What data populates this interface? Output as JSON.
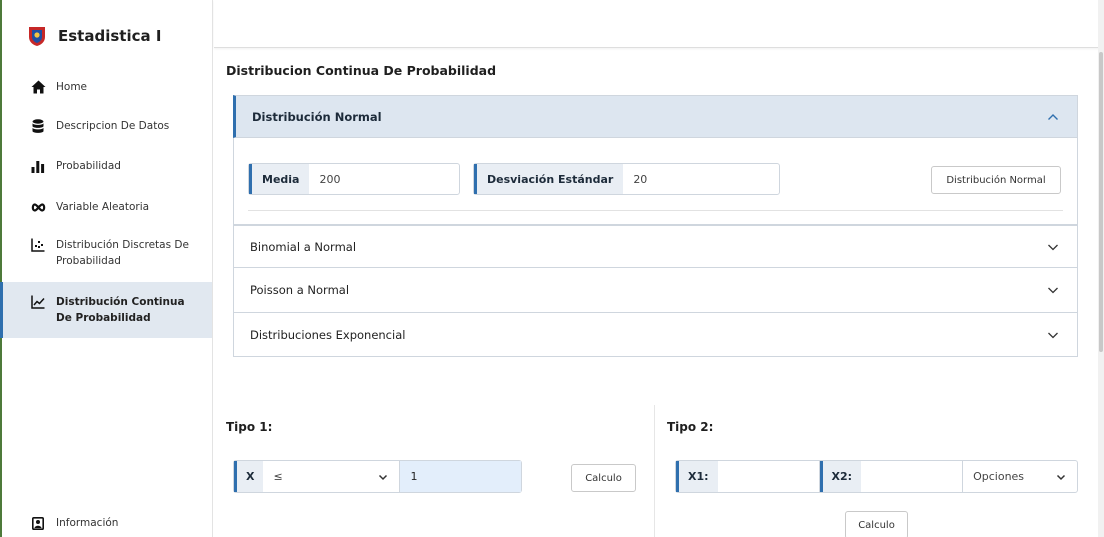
{
  "sidebar": {
    "app_title": "Estadistica I",
    "items": [
      {
        "label": "Home",
        "icon": "home-icon"
      },
      {
        "label": "Descripcion De Datos",
        "icon": "database-icon"
      },
      {
        "label": "Probabilidad",
        "icon": "bar-chart-icon"
      },
      {
        "label": "Variable Aleatoria",
        "icon": "infinity-icon"
      },
      {
        "label": "Distribución Discretas De Probabilidad",
        "icon": "scatter-icon"
      },
      {
        "label": "Distribución Continua De Probabilidad",
        "icon": "line-chart-icon",
        "active": true
      }
    ],
    "footer": {
      "label": "Información",
      "icon": "contact-icon"
    }
  },
  "main": {
    "title": "Distribucion Continua De Probabilidad",
    "accordion": [
      {
        "title": "Distribución Normal",
        "open": true
      },
      {
        "title": "Binomial a Normal",
        "open": false
      },
      {
        "title": "Poisson a Normal",
        "open": false
      },
      {
        "title": "Distribuciones Exponencial",
        "open": false
      }
    ],
    "normal": {
      "media_label": "Media",
      "media_value": "200",
      "desv_label": "Desviación Estándar",
      "desv_value": "20",
      "button": "Distribución Normal"
    },
    "tipo1": {
      "title": "Tipo 1:",
      "x_label": "X",
      "operator": "≤",
      "value": "1",
      "button": "Calculo"
    },
    "tipo2": {
      "title": "Tipo 2:",
      "x1_label": "X1:",
      "x1_value": "",
      "x2_label": "X2:",
      "x2_value": "",
      "options": "Opciones",
      "button": "Calculo"
    }
  },
  "colors": {
    "accent": "#2f6fae",
    "active_bg": "#e1e8f0",
    "accordion_open_bg": "#dde6f0",
    "input_focus_bg": "#e3eefb"
  }
}
